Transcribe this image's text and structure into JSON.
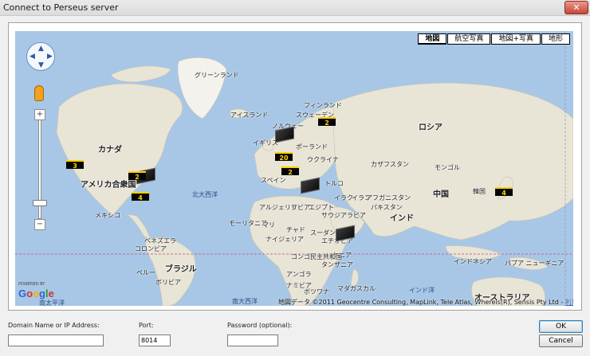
{
  "window": {
    "title": "Connect to Perseus server",
    "close_label": "✕"
  },
  "map": {
    "map_types": [
      {
        "label": "地図",
        "active": true
      },
      {
        "label": "航空写真",
        "active": false
      },
      {
        "label": "地図+写真",
        "active": false
      },
      {
        "label": "地形",
        "active": false
      }
    ],
    "labels": {
      "greenland": "グリーンランド",
      "iceland": "アイスランド",
      "finland": "フィンランド",
      "sweden": "スウェーデン",
      "norway": "ノルウェー",
      "russia": "ロシア",
      "canada": "カナダ",
      "uk": "イギリス",
      "poland": "ポーランド",
      "ukraine": "ウクライナ",
      "kazakhstan": "カザフスタン",
      "mongolia": "モンゴル",
      "spain": "スペイン",
      "turkey": "トルコ",
      "usa": "アメリカ合衆国",
      "north_atlantic": "北大西洋",
      "iraq": "イラク",
      "iran": "イラン",
      "china": "中国",
      "korea": "韓国",
      "algeria": "アルジェリア",
      "libya": "リビア",
      "egypt": "エジプト",
      "afghanistan": "アフガニスタン",
      "pakistan": "パキスタン",
      "mexico": "メキシコ",
      "mauritania": "モーリタニア",
      "mali": "マリ",
      "saudi": "サウジアラビア",
      "india": "インド",
      "chad": "チャド",
      "sudan": "スーダン",
      "nigeria": "ナイジェリア",
      "ethiopia": "エチオピア",
      "venezuela": "ベネズエラ",
      "colombia": "コロンビア",
      "kenya": "ケニア",
      "congo": "コンゴ民主共和国",
      "tanzania": "タンザニア",
      "indonesia": "インドネシア",
      "papua": "パプア ニューギニア",
      "brazil": "ブラジル",
      "peru": "ペルー",
      "bolivia": "ボリビア",
      "angola": "アンゴラ",
      "namibia": "ナミビア",
      "botswana": "ボツワナ",
      "madagascar": "マダガスカル",
      "indian_ocean": "インド洋",
      "australia": "オーストラリア",
      "south_pacific": "南太平洋",
      "south_atlantic": "南大西洋"
    },
    "markers": [
      {
        "id": "canada",
        "count": "3"
      },
      {
        "id": "us-east",
        "count": "2"
      },
      {
        "id": "us-south",
        "count": "4"
      },
      {
        "id": "scandinavia",
        "count": "2"
      },
      {
        "id": "uk",
        "count": "20"
      },
      {
        "id": "central-europe",
        "count": "2"
      },
      {
        "id": "japan",
        "count": "4"
      }
    ],
    "google": {
      "powered": "POWERED BY",
      "logo": "Google"
    },
    "copyright": {
      "text": "地図データ ©2011 Geocentre Consulting, MapLink, Tele Atlas, Whereis(R), Sensis Pty Ltd - ",
      "link": "利用規約"
    },
    "zoom_in": "+",
    "zoom_out": "−"
  },
  "form": {
    "domain_label": "Domain Name or IP Address:",
    "domain_value": "",
    "port_label": "Port:",
    "port_value": "8014",
    "password_label": "Password  (optional):",
    "password_value": "",
    "ok_label": "OK",
    "cancel_label": "Cancel"
  }
}
